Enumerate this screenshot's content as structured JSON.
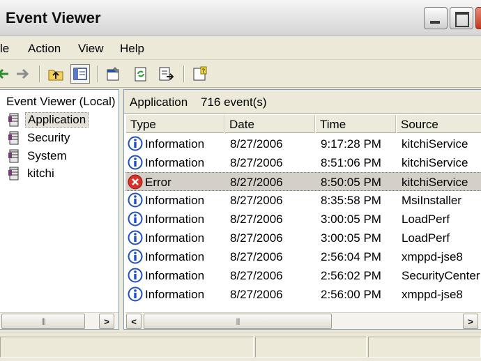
{
  "window": {
    "title": "Event Viewer"
  },
  "menu": {
    "file": "le",
    "action": "Action",
    "view": "View",
    "help": "Help"
  },
  "toolbar": {
    "buttons": [
      "back-icon",
      "forward-icon",
      "up-folder-icon",
      "show-hide-tree-icon",
      "properties-icon",
      "refresh-icon",
      "export-list-icon",
      "help-icon"
    ]
  },
  "tree": {
    "root": "Event Viewer (Local)",
    "items": [
      {
        "label": "Application",
        "selected": true
      },
      {
        "label": "Security"
      },
      {
        "label": "System"
      },
      {
        "label": "kitchi"
      }
    ]
  },
  "list": {
    "log_name": "Application",
    "event_count": "716 event(s)",
    "columns": {
      "type": "Type",
      "date": "Date",
      "time": "Time",
      "source": "Source"
    },
    "rows": [
      {
        "type": "Information",
        "date": "8/27/2006",
        "time": "9:17:28 PM",
        "source": "kitchiService",
        "icon": "info-icon"
      },
      {
        "type": "Information",
        "date": "8/27/2006",
        "time": "8:51:06 PM",
        "source": "kitchiService",
        "icon": "info-icon"
      },
      {
        "type": "Error",
        "date": "8/27/2006",
        "time": "8:50:05 PM",
        "source": "kitchiService",
        "icon": "error-icon",
        "selected": true
      },
      {
        "type": "Information",
        "date": "8/27/2006",
        "time": "8:35:58 PM",
        "source": "MsiInstaller",
        "icon": "info-icon"
      },
      {
        "type": "Information",
        "date": "8/27/2006",
        "time": "3:00:05 PM",
        "source": "LoadPerf",
        "icon": "info-icon"
      },
      {
        "type": "Information",
        "date": "8/27/2006",
        "time": "3:00:05 PM",
        "source": "LoadPerf",
        "icon": "info-icon"
      },
      {
        "type": "Information",
        "date": "8/27/2006",
        "time": "2:56:04 PM",
        "source": "xmppd-jse8",
        "icon": "info-icon"
      },
      {
        "type": "Information",
        "date": "8/27/2006",
        "time": "2:56:02 PM",
        "source": "SecurityCenter",
        "icon": "info-icon"
      },
      {
        "type": "Information",
        "date": "8/27/2006",
        "time": "2:56:00 PM",
        "source": "xmppd-jse8",
        "icon": "info-icon"
      }
    ]
  },
  "colors": {
    "selection": "#d4d0c8",
    "chrome": "#ece9d8",
    "error": "#d9302c",
    "info": "#1f4fbf"
  }
}
